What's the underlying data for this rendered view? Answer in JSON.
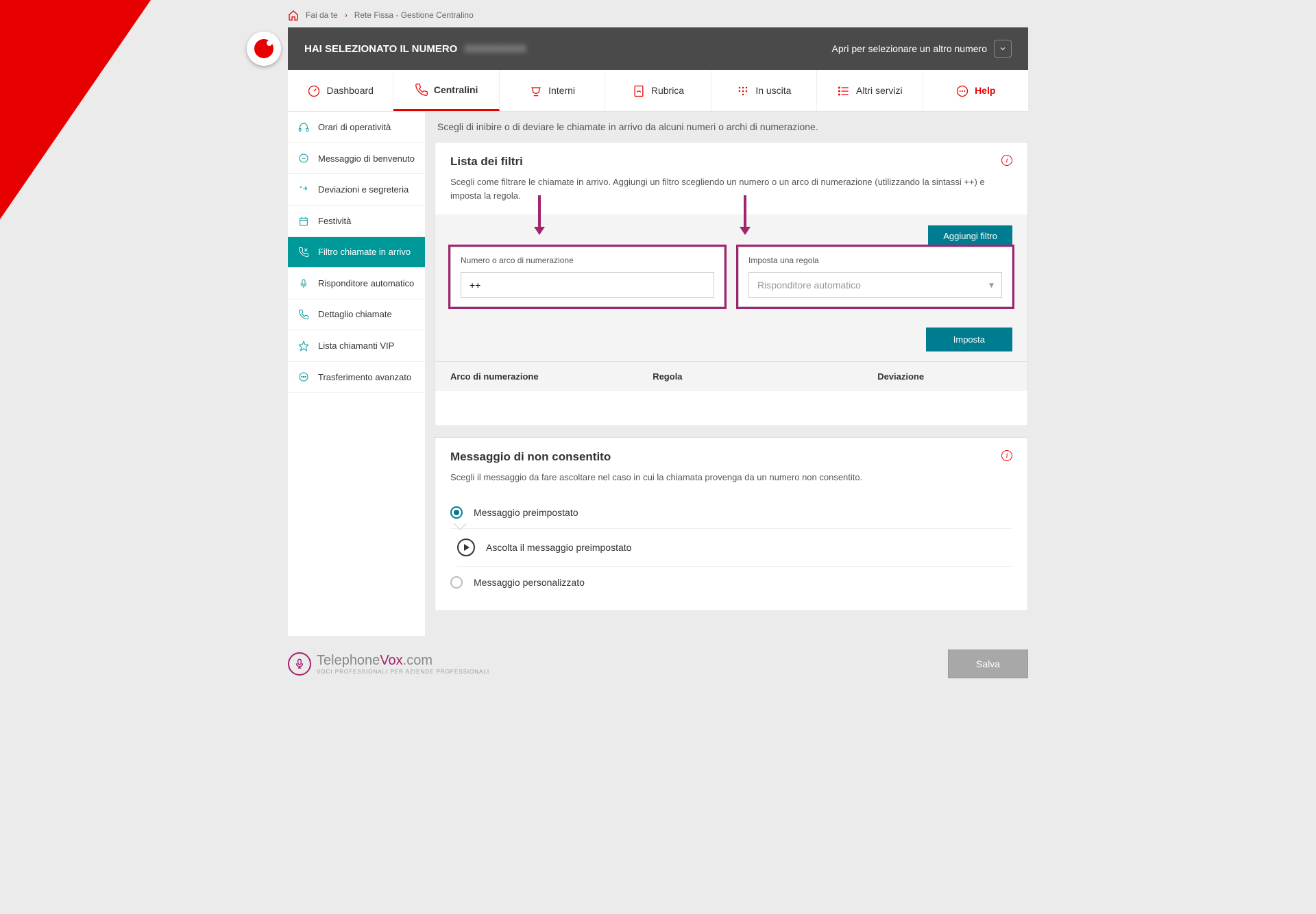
{
  "breadcrumb": {
    "home": "Fai da te",
    "page": "Rete Fissa - Gestione Centralino"
  },
  "header": {
    "selected_label": "HAI SELEZIONATO IL NUMERO",
    "selected_number": "XXXXXXXXX",
    "open_other": "Apri per selezionare un altro numero"
  },
  "tabs": [
    {
      "label": "Dashboard"
    },
    {
      "label": "Centralini"
    },
    {
      "label": "Interni"
    },
    {
      "label": "Rubrica"
    },
    {
      "label": "In uscita"
    },
    {
      "label": "Altri servizi"
    },
    {
      "label": "Help"
    }
  ],
  "sidebar": {
    "items": [
      {
        "label": "Orari di operatività"
      },
      {
        "label": "Messaggio di benvenuto"
      },
      {
        "label": "Deviazioni e segreteria"
      },
      {
        "label": "Festività"
      },
      {
        "label": "Filtro chiamate in arrivo"
      },
      {
        "label": "Risponditore automatico"
      },
      {
        "label": "Dettaglio chiamate"
      },
      {
        "label": "Lista chiamanti VIP"
      },
      {
        "label": "Trasferimento avanzato"
      }
    ]
  },
  "main": {
    "intro": "Scegli di inibire o di deviare le chiamate in arrivo da alcuni numeri o archi di numerazione.",
    "filters": {
      "title": "Lista dei filtri",
      "desc": "Scegli come filtrare le chiamate in arrivo. Aggiungi un filtro scegliendo un numero o un arco di numerazione (utilizzando la sintassi ++) e imposta la regola.",
      "add_btn": "Aggiungi filtro",
      "field_number_label": "Numero o arco di numerazione",
      "field_number_value": "++",
      "field_rule_label": "Imposta una regola",
      "field_rule_placeholder": "Risponditore automatico",
      "set_btn": "Imposta",
      "th_arco": "Arco di numerazione",
      "th_regola": "Regola",
      "th_dev": "Deviazione"
    },
    "notallowed": {
      "title": "Messaggio di non consentito",
      "desc": "Scegli il messaggio da fare ascoltare nel caso in cui la chiamata provenga da un numero non consentito.",
      "opt_preset": "Messaggio preimpostato",
      "opt_listen": "Ascolta il messaggio preimpostato",
      "opt_custom": "Messaggio personalizzato"
    },
    "save_btn": "Salva"
  },
  "footer": {
    "brand1": "Telephone",
    "brand2": "Vox",
    "brand3": ".com",
    "tagline": "VOCI PROFESSIONALI PER AZIENDE PROFESSIONALI"
  }
}
